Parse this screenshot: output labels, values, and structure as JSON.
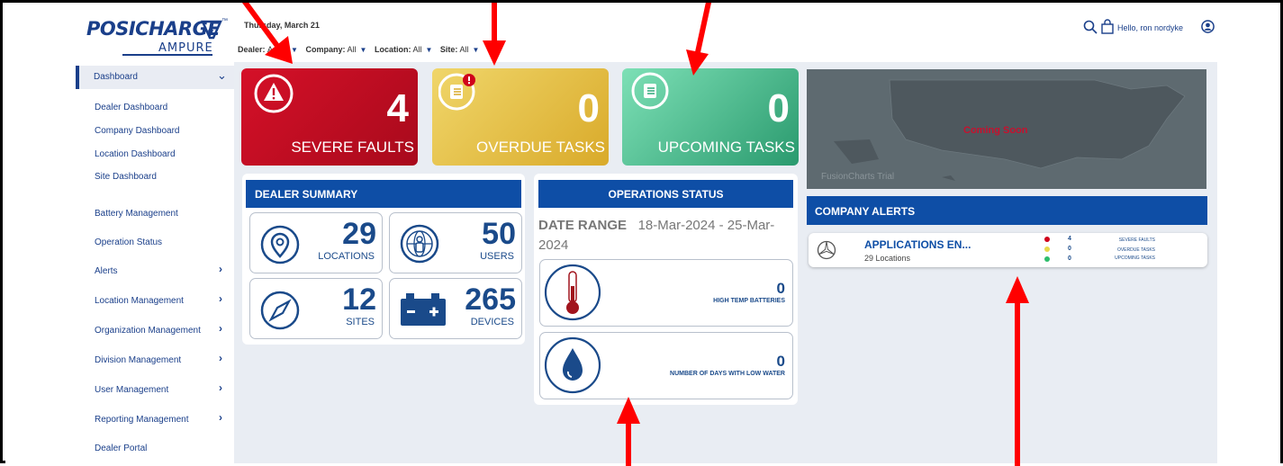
{
  "brand": {
    "name": "POSICHARGE",
    "sub": "AMPURE",
    "tm": "™"
  },
  "header": {
    "date": "Thursday, March 21",
    "filters": [
      {
        "label": "Dealer:",
        "value": "Applications Eng..."
      },
      {
        "label": "Company:",
        "value": "All"
      },
      {
        "label": "Location:",
        "value": "All"
      },
      {
        "label": "Site:",
        "value": "All"
      }
    ],
    "greeting": "Hello, ron nordyke"
  },
  "sidebar": {
    "active": "Dashboard",
    "sub_items": [
      "Dealer Dashboard",
      "Company Dashboard",
      "Location Dashboard",
      "Site Dashboard"
    ],
    "items": [
      {
        "label": "Battery Management",
        "expandable": false
      },
      {
        "label": "Operation Status",
        "expandable": false
      },
      {
        "label": "Alerts",
        "expandable": true
      },
      {
        "label": "Location Management",
        "expandable": true
      },
      {
        "label": "Organization Management",
        "expandable": true
      },
      {
        "label": "Division Management",
        "expandable": true
      },
      {
        "label": "User Management",
        "expandable": true
      },
      {
        "label": "Reporting Management",
        "expandable": true
      },
      {
        "label": "Dealer Portal",
        "expandable": false
      }
    ]
  },
  "tiles": [
    {
      "count": "4",
      "label": "SEVERE FAULTS",
      "icon": "warning-icon",
      "color": "#c8102e"
    },
    {
      "count": "0",
      "label": "OVERDUE TASKS",
      "icon": "task-list-alert-icon",
      "color": "#e6c53f"
    },
    {
      "count": "0",
      "label": "UPCOMING TASKS",
      "icon": "task-list-icon",
      "color": "#2fa87a"
    }
  ],
  "dealer_summary": {
    "title": "DEALER SUMMARY",
    "stats": [
      {
        "value": "29",
        "label": "LOCATIONS",
        "icon": "location-pin-icon"
      },
      {
        "value": "50",
        "label": "USERS",
        "icon": "globe-user-icon"
      },
      {
        "value": "12",
        "label": "SITES",
        "icon": "compass-icon"
      },
      {
        "value": "265",
        "label": "DEVICES",
        "icon": "battery-icon"
      }
    ]
  },
  "operations": {
    "title": "OPERATIONS STATUS",
    "date_label": "DATE RANGE",
    "date_value": "18-Mar-2024 - 25-Mar-2024",
    "metrics": [
      {
        "value": "0",
        "label": "HIGH TEMP BATTERIES",
        "icon": "thermometer-icon"
      },
      {
        "value": "0",
        "label": "NUMBER OF DAYS WITH LOW WATER",
        "icon": "water-drop-icon"
      }
    ]
  },
  "map": {
    "overlay": "Coming Soon",
    "watermark": "FusionCharts Trial"
  },
  "company_alerts": {
    "title": "COMPANY ALERTS",
    "rows": [
      {
        "name": "APPLICATIONS EN...",
        "sub": "29 Locations",
        "counts": [
          {
            "value": "4",
            "label": "SEVERE FAULTS",
            "color": "#d0021b"
          },
          {
            "value": "0",
            "label": "OVERDUE TASKS",
            "color": "#e8d84a"
          },
          {
            "value": "0",
            "label": "UPCOMING TASKS",
            "color": "#2ebd6b"
          }
        ]
      }
    ]
  }
}
